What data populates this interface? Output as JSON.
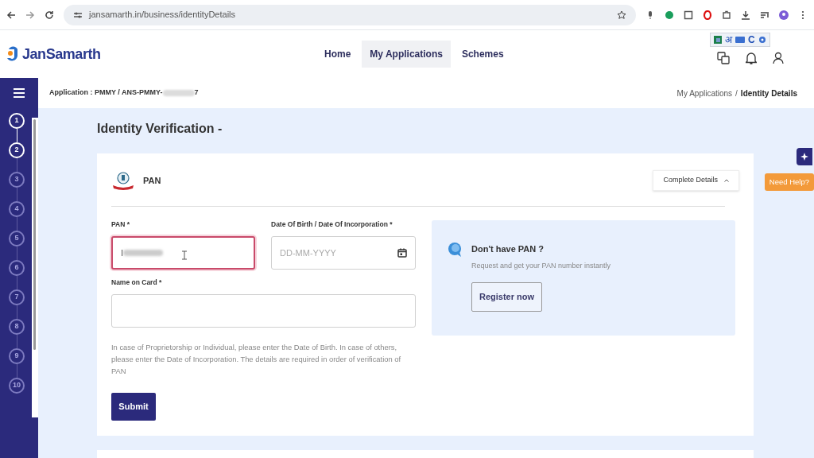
{
  "browser": {
    "url": "jansamarth.in/business/identityDetails",
    "ime_bar": {
      "letter": "अ",
      "mode": "C"
    }
  },
  "header": {
    "logo": "JanSamarth",
    "nav": [
      {
        "label": "Home",
        "selected": false
      },
      {
        "label": "My Applications",
        "selected": true
      },
      {
        "label": "Schemes",
        "selected": false
      }
    ]
  },
  "breadcrumb_bar": {
    "application": "Application : PMMY / ANS-PMMY-",
    "application_end": "7",
    "trail": [
      {
        "label": "My Applications",
        "current": false
      },
      {
        "label": "Identity Details",
        "current": true
      }
    ],
    "separator": "/"
  },
  "steps": [
    {
      "label": "1",
      "enabled": true
    },
    {
      "label": "2",
      "enabled": true
    },
    {
      "label": "3",
      "enabled": false
    },
    {
      "label": "4",
      "enabled": false
    },
    {
      "label": "5",
      "enabled": false
    },
    {
      "label": "6",
      "enabled": false
    },
    {
      "label": "7",
      "enabled": false
    },
    {
      "label": "8",
      "enabled": false
    },
    {
      "label": "9",
      "enabled": false
    },
    {
      "label": "10",
      "enabled": false
    }
  ],
  "page_title": "Identity Verification -",
  "card": {
    "title": "PAN",
    "toggle": "Complete Details",
    "expanded": true,
    "fields": [
      {
        "label": "PAN *",
        "value": "I",
        "focused": true
      },
      {
        "label": "Date Of Birth / Date Of Incorporation *",
        "placeholder": "DD-MM-YYYY",
        "focused": false
      },
      {
        "label": "Name on Card *",
        "focused": false
      }
    ],
    "note": "In case of Proprietorship or Individual, please enter the Date of Birth. In case of others, please enter the Date of Incorporation. The details are required in order of verification of PAN",
    "submit": "Submit",
    "info": {
      "title": "Don't have PAN ?",
      "text": "Request and get your PAN number instantly",
      "button": "Register now"
    }
  },
  "help": "Need Help?"
}
